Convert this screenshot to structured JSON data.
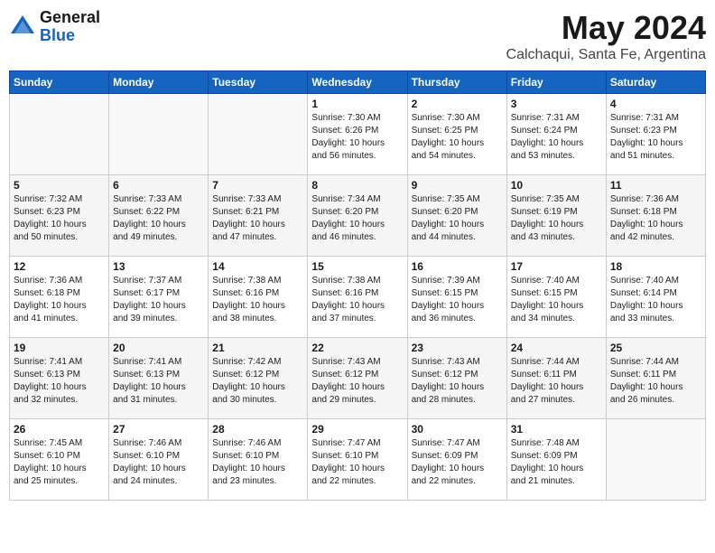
{
  "header": {
    "logo_general": "General",
    "logo_blue": "Blue",
    "month_year": "May 2024",
    "location": "Calchaqui, Santa Fe, Argentina"
  },
  "days_of_week": [
    "Sunday",
    "Monday",
    "Tuesday",
    "Wednesday",
    "Thursday",
    "Friday",
    "Saturday"
  ],
  "weeks": [
    [
      {
        "day": "",
        "info": ""
      },
      {
        "day": "",
        "info": ""
      },
      {
        "day": "",
        "info": ""
      },
      {
        "day": "1",
        "info": "Sunrise: 7:30 AM\nSunset: 6:26 PM\nDaylight: 10 hours\nand 56 minutes."
      },
      {
        "day": "2",
        "info": "Sunrise: 7:30 AM\nSunset: 6:25 PM\nDaylight: 10 hours\nand 54 minutes."
      },
      {
        "day": "3",
        "info": "Sunrise: 7:31 AM\nSunset: 6:24 PM\nDaylight: 10 hours\nand 53 minutes."
      },
      {
        "day": "4",
        "info": "Sunrise: 7:31 AM\nSunset: 6:23 PM\nDaylight: 10 hours\nand 51 minutes."
      }
    ],
    [
      {
        "day": "5",
        "info": "Sunrise: 7:32 AM\nSunset: 6:23 PM\nDaylight: 10 hours\nand 50 minutes."
      },
      {
        "day": "6",
        "info": "Sunrise: 7:33 AM\nSunset: 6:22 PM\nDaylight: 10 hours\nand 49 minutes."
      },
      {
        "day": "7",
        "info": "Sunrise: 7:33 AM\nSunset: 6:21 PM\nDaylight: 10 hours\nand 47 minutes."
      },
      {
        "day": "8",
        "info": "Sunrise: 7:34 AM\nSunset: 6:20 PM\nDaylight: 10 hours\nand 46 minutes."
      },
      {
        "day": "9",
        "info": "Sunrise: 7:35 AM\nSunset: 6:20 PM\nDaylight: 10 hours\nand 44 minutes."
      },
      {
        "day": "10",
        "info": "Sunrise: 7:35 AM\nSunset: 6:19 PM\nDaylight: 10 hours\nand 43 minutes."
      },
      {
        "day": "11",
        "info": "Sunrise: 7:36 AM\nSunset: 6:18 PM\nDaylight: 10 hours\nand 42 minutes."
      }
    ],
    [
      {
        "day": "12",
        "info": "Sunrise: 7:36 AM\nSunset: 6:18 PM\nDaylight: 10 hours\nand 41 minutes."
      },
      {
        "day": "13",
        "info": "Sunrise: 7:37 AM\nSunset: 6:17 PM\nDaylight: 10 hours\nand 39 minutes."
      },
      {
        "day": "14",
        "info": "Sunrise: 7:38 AM\nSunset: 6:16 PM\nDaylight: 10 hours\nand 38 minutes."
      },
      {
        "day": "15",
        "info": "Sunrise: 7:38 AM\nSunset: 6:16 PM\nDaylight: 10 hours\nand 37 minutes."
      },
      {
        "day": "16",
        "info": "Sunrise: 7:39 AM\nSunset: 6:15 PM\nDaylight: 10 hours\nand 36 minutes."
      },
      {
        "day": "17",
        "info": "Sunrise: 7:40 AM\nSunset: 6:15 PM\nDaylight: 10 hours\nand 34 minutes."
      },
      {
        "day": "18",
        "info": "Sunrise: 7:40 AM\nSunset: 6:14 PM\nDaylight: 10 hours\nand 33 minutes."
      }
    ],
    [
      {
        "day": "19",
        "info": "Sunrise: 7:41 AM\nSunset: 6:13 PM\nDaylight: 10 hours\nand 32 minutes."
      },
      {
        "day": "20",
        "info": "Sunrise: 7:41 AM\nSunset: 6:13 PM\nDaylight: 10 hours\nand 31 minutes."
      },
      {
        "day": "21",
        "info": "Sunrise: 7:42 AM\nSunset: 6:12 PM\nDaylight: 10 hours\nand 30 minutes."
      },
      {
        "day": "22",
        "info": "Sunrise: 7:43 AM\nSunset: 6:12 PM\nDaylight: 10 hours\nand 29 minutes."
      },
      {
        "day": "23",
        "info": "Sunrise: 7:43 AM\nSunset: 6:12 PM\nDaylight: 10 hours\nand 28 minutes."
      },
      {
        "day": "24",
        "info": "Sunrise: 7:44 AM\nSunset: 6:11 PM\nDaylight: 10 hours\nand 27 minutes."
      },
      {
        "day": "25",
        "info": "Sunrise: 7:44 AM\nSunset: 6:11 PM\nDaylight: 10 hours\nand 26 minutes."
      }
    ],
    [
      {
        "day": "26",
        "info": "Sunrise: 7:45 AM\nSunset: 6:10 PM\nDaylight: 10 hours\nand 25 minutes."
      },
      {
        "day": "27",
        "info": "Sunrise: 7:46 AM\nSunset: 6:10 PM\nDaylight: 10 hours\nand 24 minutes."
      },
      {
        "day": "28",
        "info": "Sunrise: 7:46 AM\nSunset: 6:10 PM\nDaylight: 10 hours\nand 23 minutes."
      },
      {
        "day": "29",
        "info": "Sunrise: 7:47 AM\nSunset: 6:10 PM\nDaylight: 10 hours\nand 22 minutes."
      },
      {
        "day": "30",
        "info": "Sunrise: 7:47 AM\nSunset: 6:09 PM\nDaylight: 10 hours\nand 22 minutes."
      },
      {
        "day": "31",
        "info": "Sunrise: 7:48 AM\nSunset: 6:09 PM\nDaylight: 10 hours\nand 21 minutes."
      },
      {
        "day": "",
        "info": ""
      }
    ]
  ]
}
